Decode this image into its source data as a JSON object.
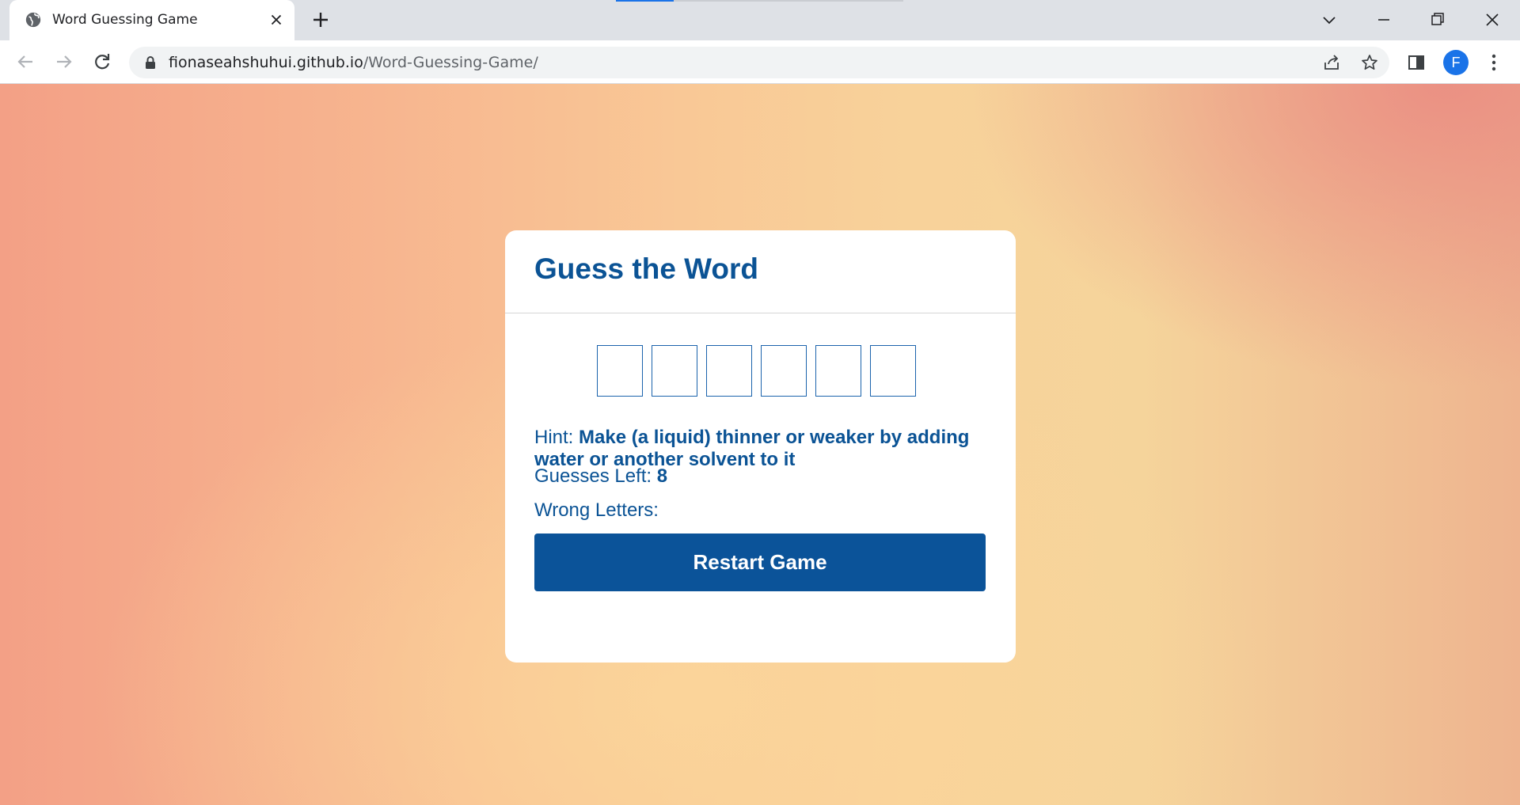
{
  "browser": {
    "tab_title": "Word Guessing Game",
    "url_host": "fionaseahshuhui.github.io",
    "url_path": "/Word-Guessing-Game/",
    "profile_initial": "F"
  },
  "game": {
    "title": "Guess the Word",
    "slot_count": 6,
    "slots": [
      "",
      "",
      "",
      "",
      "",
      ""
    ],
    "hint_label": "Hint:",
    "hint_text": "Make (a liquid) thinner or weaker by adding water or another solvent to it",
    "guesses_label": "Guesses Left:",
    "guesses_left": "8",
    "wrong_label": "Wrong Letters:",
    "wrong_letters": "",
    "restart_label": "Restart Game"
  },
  "colors": {
    "accent": "#0b5395",
    "button": "#0b5399",
    "bg_left": "#f3a086",
    "bg_center": "#f9d29a"
  }
}
